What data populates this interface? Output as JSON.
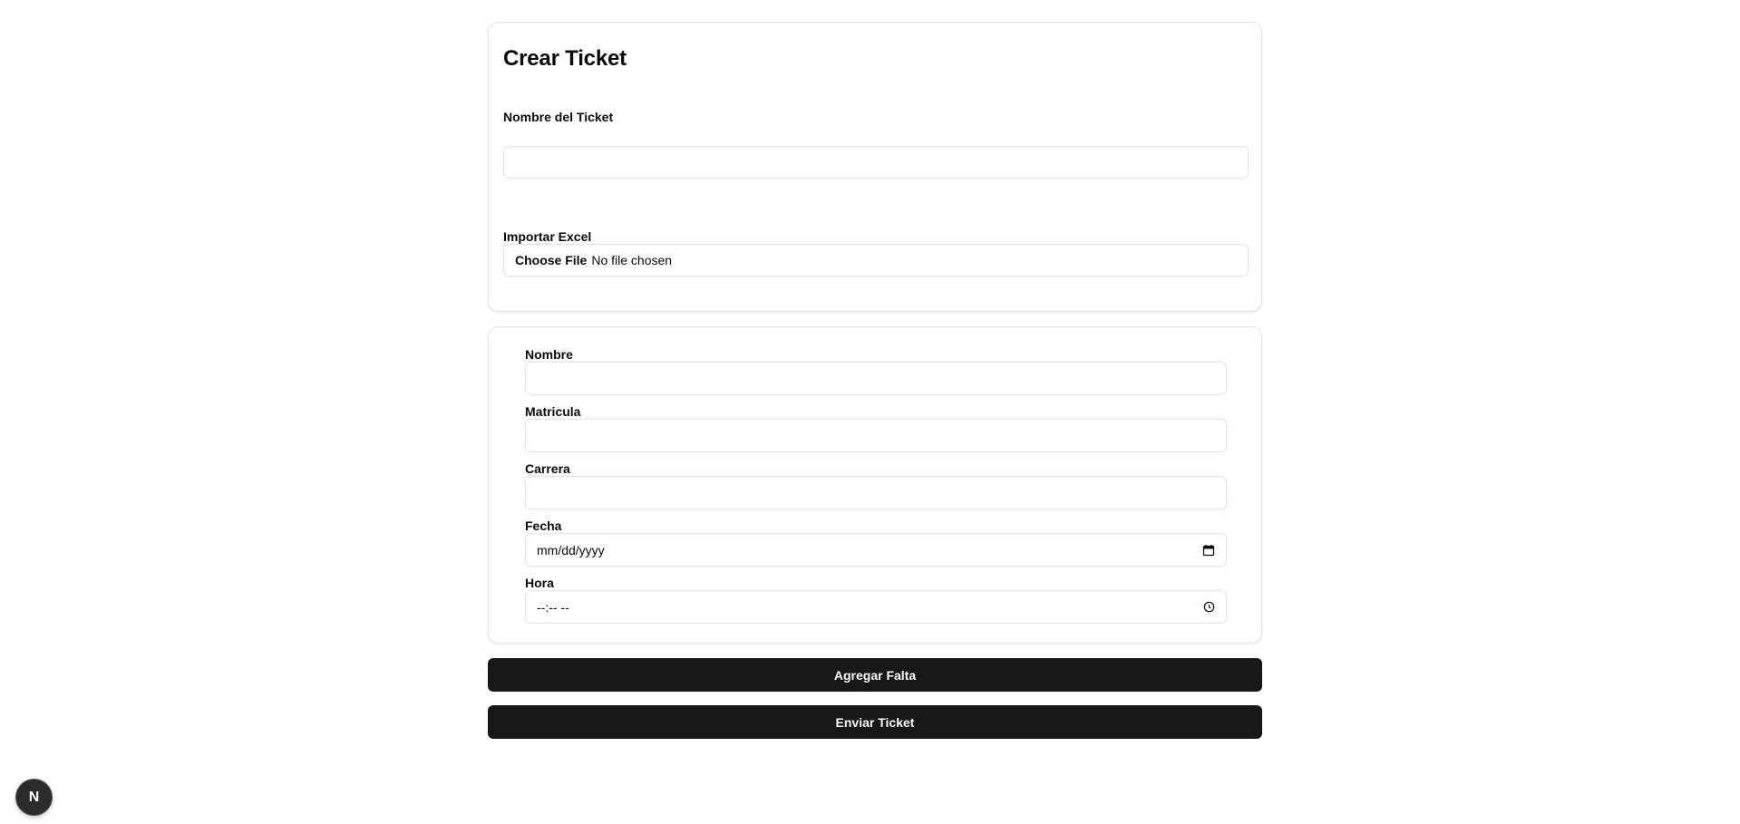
{
  "ticket": {
    "title": "Crear Ticket",
    "name_label": "Nombre del Ticket",
    "name_value": "",
    "import_label": "Importar Excel",
    "file_button": "Choose File",
    "file_status": "No file chosen"
  },
  "falta": {
    "nombre_label": "Nombre",
    "nombre_value": "",
    "matricula_label": "Matricula",
    "matricula_value": "",
    "carrera_label": "Carrera",
    "carrera_value": "",
    "fecha_label": "Fecha",
    "fecha_placeholder": "mm/dd/yyyy",
    "hora_label": "Hora",
    "hora_placeholder": "--:-- --"
  },
  "actions": {
    "add_label": "Agregar Falta",
    "send_label": "Enviar Ticket"
  },
  "badge": {
    "letter": "N"
  },
  "icons": {
    "date": "calendar-icon",
    "time": "clock-icon"
  },
  "colors": {
    "button_bg": "#171717",
    "button_text": "#fafafa",
    "border": "#e4e4e7",
    "badge_bg": "#2b2b2b"
  }
}
